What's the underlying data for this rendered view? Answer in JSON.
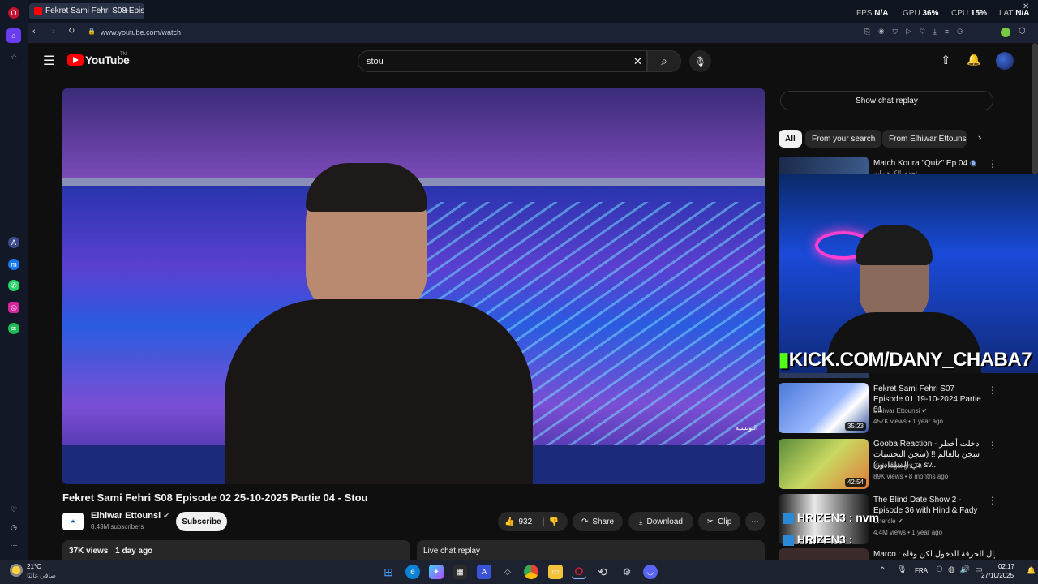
{
  "browser": {
    "tab_title": "Fekret Sami Fehri S08 Epis",
    "url": "www.youtube.com/watch",
    "hud": {
      "fps_label": "FPS",
      "fps": "N/A",
      "gpu_label": "GPU",
      "gpu": "36%",
      "cpu_label": "CPU",
      "cpu": "15%",
      "lat_label": "LAT",
      "lat": "N/A"
    }
  },
  "youtube": {
    "logo": "YouTube",
    "region": "TN",
    "search_value": "stou",
    "video": {
      "title": "Fekret Sami Fehri S08 Episode 02 25-10-2025 Partie 04 - Stou",
      "channel": "Elhiwar Ettounsi",
      "subscribers": "8.43M subscribers",
      "subscribe_label": "Subscribe",
      "likes": "932",
      "share_label": "Share",
      "download_label": "Download",
      "clip_label": "Clip",
      "views": "37K views",
      "date": "1 day ago",
      "live_chat_label": "Live chat replay",
      "watermark": "التونسية"
    },
    "chat_replay_label": "Show chat replay",
    "chips": [
      "All",
      "From your search",
      "From Elhiwar Ettounsi"
    ],
    "recs": [
      {
        "title": "Match Koura \"Quiz\" Ep 04",
        "subtitle": "تحدي الكرة مات"
      },
      {
        "title": "Fekret Sami Fehri S07 Episode 01 19-10-2024 Partie 01",
        "channel": "Elhiwar Ettounsi",
        "meta": "457K views • 1 year ago",
        "duration": "35:23"
      },
      {
        "title": "Gooba Reaction - دخلت أخطر سجن بالعالم !! (سجن التحسبات في السلفادور) sv...",
        "channel": "Kick Highlight Tn",
        "meta": "89K views • 8 months ago",
        "duration": "42:54"
      },
      {
        "title": "The Blind Date Show 2 - Episode 36 with Hind & Fady",
        "channel": "Chercle",
        "meta": "4.4M views • 1 year ago"
      },
      {
        "title": "Marco : أهوال الحرقة الدخول لكن وقاه ..."
      }
    ]
  },
  "overlay": {
    "kick_text": "KICK.COM/DANY_CHABA7",
    "chat_lines": [
      "HRIZEN3 : nvm",
      "HRIZEN3 :"
    ]
  },
  "taskbar": {
    "weather_temp": "21°C",
    "weather_desc": "صافي غالبًا",
    "lang": "FRA",
    "time": "02:17",
    "date": "27/10/2025"
  },
  "colors": {
    "accent": "#ff0000",
    "kick_green": "#53fc18",
    "background": "#0f0f0f"
  }
}
